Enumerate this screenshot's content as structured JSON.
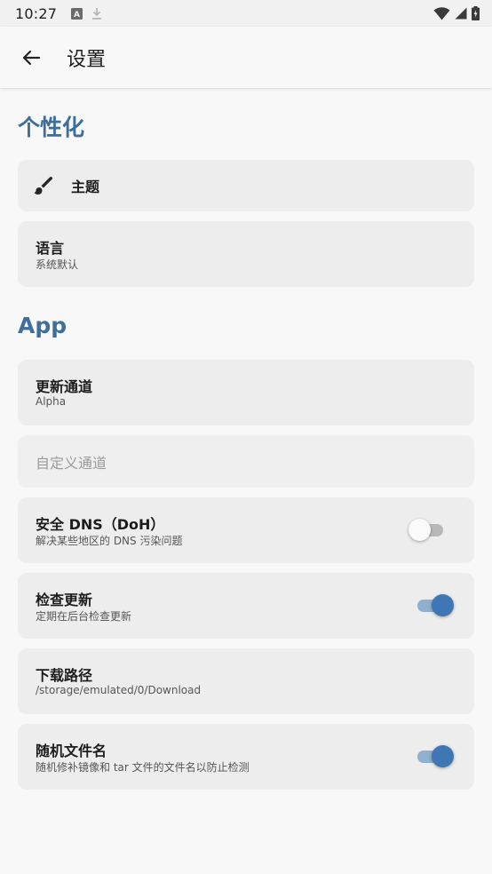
{
  "status_bar": {
    "time": "10:27"
  },
  "app_bar": {
    "title": "设置"
  },
  "sections": {
    "personalization": {
      "title": "个性化",
      "theme": {
        "label": "主题"
      },
      "language": {
        "label": "语言",
        "value": "系统默认"
      }
    },
    "app": {
      "title": "App",
      "update_channel": {
        "label": "更新通道",
        "value": "Alpha"
      },
      "custom_channel": {
        "label": "自定义通道"
      },
      "secure_dns": {
        "label": "安全 DNS（DoH）",
        "description": "解决某些地区的 DNS 污染问题",
        "enabled": false
      },
      "check_updates": {
        "label": "检查更新",
        "description": "定期在后台检查更新",
        "enabled": true
      },
      "download_path": {
        "label": "下载路径",
        "value": "/storage/emulated/0/Download"
      },
      "random_filename": {
        "label": "随机文件名",
        "description": "随机修补镜像和 tar 文件的文件名以防止检测",
        "enabled": true
      }
    }
  },
  "colors": {
    "accent": "#3d6e9c",
    "switch_on_thumb": "#3f77b5",
    "switch_on_track": "#8fb0cf",
    "card_background": "#ededed"
  },
  "icons": {
    "back": "arrow-left-icon",
    "theme": "paintbrush-icon"
  }
}
